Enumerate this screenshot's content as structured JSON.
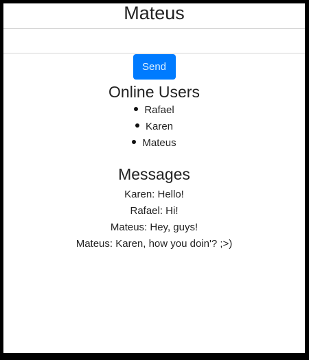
{
  "header": {
    "title": "Mateus"
  },
  "composer": {
    "input_value": "",
    "input_placeholder": "",
    "send_label": "Send"
  },
  "online_users": {
    "title": "Online Users",
    "users": [
      "Rafael",
      "Karen",
      "Mateus"
    ]
  },
  "messages": {
    "title": "Messages",
    "items": [
      "Karen: Hello!",
      "Rafael: Hi!",
      "Mateus: Hey, guys!",
      "Mateus: Karen, how you doin'? ;>)"
    ]
  },
  "colors": {
    "send_button": "#007bff",
    "frame_border": "#000000"
  }
}
